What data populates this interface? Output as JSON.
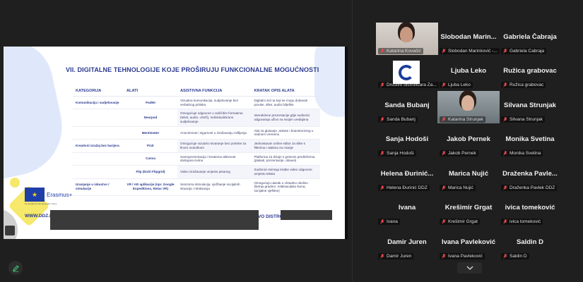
{
  "slide": {
    "title": "VII. DIGITALNE TEHNOLOGIJE KOJE PROŠIRUJU FUNKCIONALNE MOGUĆNOSTI",
    "headers": [
      "KATEGORIJA",
      "ALATI",
      "ASISTIVNA FUNKCIJA",
      "KRATAK OPIS ALATA"
    ],
    "rows": [
      {
        "cat": "Komunikacija i sudjelovanje",
        "tool": "Padlet",
        "func": "Vizualna komunikacija, sudjelovanje bez verbalnog pritiska",
        "desc": "Digitalni zid na koji se mogu dodavati poruke, slike, audio bilješke"
      },
      {
        "cat": "",
        "tool": "Nearpod",
        "func": "Omogućuje odgovore u različitim formatima (tekst, audio, crteži), individualizirano sudjelovanje",
        "desc": "Interaktivne prezentacije gdje sudionici odgovaraju uživo na svojim uređajima"
      },
      {
        "cat": "",
        "tool": "Mentimeter",
        "func": "Anonimnost i sigurnost u izražavanju mišljenja",
        "desc": "Alat za glasanje, ankete i brainstorming u realnom vremenu"
      },
      {
        "cat": "Kreativni izražaj bez barijera",
        "tool": "Pixlr",
        "func": "Omogućuje vizualno stvaranje bez potrebe za finom motorikom",
        "desc": "Jednostavan online editor za slike s filterima i alatima za crtanje"
      },
      {
        "cat": "",
        "tool": "Canva",
        "func": "Samoprezentacija i kreativna aktivnost dostupna svima",
        "desc": "Platforma za dizajn s gotovim predlošcima (plakati, prezentacije, obavei)"
      },
      {
        "cat": "",
        "tool": "Flip (bivši Flipgrid)",
        "func": "Video izražavanje umjesto pisanog",
        "desc": "Sudionici snimaju kratke video odgovore umjesto teksta"
      },
      {
        "cat": "Uranjanje u iskustvo / simulacije",
        "tool": "VR / AR aplikacije (npr. Google Expeditions, Relax VR)",
        "func": "Senzorna stimulacija, vježbanje socijalnih situacija i relaksacija",
        "desc": "Omogućuju ulazak u virtualnu okolinu (šetnja gradom, relaksacijska šuma, socijalne vještine)"
      }
    ],
    "eu_text": "Erasmus+",
    "eu_sub": "Co-funded by the European Union",
    "website": "WWW.DDZ.H",
    "footer_right": "TVO DISTRO"
  },
  "participants": [
    {
      "name": "",
      "label": "Katarina Kovačić",
      "video": true,
      "active": true
    },
    {
      "name": "Slobodan Marin...",
      "label": "Slobodan Marinković -..."
    },
    {
      "name": "Gabriela Čabraja",
      "label": "Gabriela Čabraja"
    },
    {
      "name": "",
      "label": "Društvo distrofičara Za...",
      "logo": true
    },
    {
      "name": "Ljuba Leko",
      "label": "Ljuba Leko"
    },
    {
      "name": "Ružica grabovac",
      "label": "Ružica grabovac"
    },
    {
      "name": "Sanda Bubanj",
      "label": "Sanda Bubanj"
    },
    {
      "name": "",
      "label": "Katarina Strunjak",
      "video": true
    },
    {
      "name": "Silvana Strunjak",
      "label": "Silvana Strunjak"
    },
    {
      "name": "Sanja Hodoši",
      "label": "Sanja Hodoši"
    },
    {
      "name": "Jakob Pernek",
      "label": "Jakob Pernek"
    },
    {
      "name": "Monika Svetina",
      "label": "Monika Svetina"
    },
    {
      "name": "Helena Đurinić...",
      "label": "Helena Đurinić DDZ"
    },
    {
      "name": "Marica Nujić",
      "label": "Marica Nujić"
    },
    {
      "name": "Draženka Pavle...",
      "label": "Draženka Pavlek DDZ"
    },
    {
      "name": "Ivana",
      "label": "Ivana"
    },
    {
      "name": "Krešimir Grgat",
      "label": "Krešimir Grgat"
    },
    {
      "name": "ivica tomeković",
      "label": "ivica tomeković"
    },
    {
      "name": "Damir Juren",
      "label": "Damir Juren"
    },
    {
      "name": "Ivana Pavleković",
      "label": "Ivana Pavleković"
    },
    {
      "name": "Saldin D",
      "label": "Saldin D"
    }
  ],
  "colors": {
    "active_border": "#41d37a",
    "mic_muted": "#e5484d",
    "slide_blue": "#2b3a8f"
  }
}
